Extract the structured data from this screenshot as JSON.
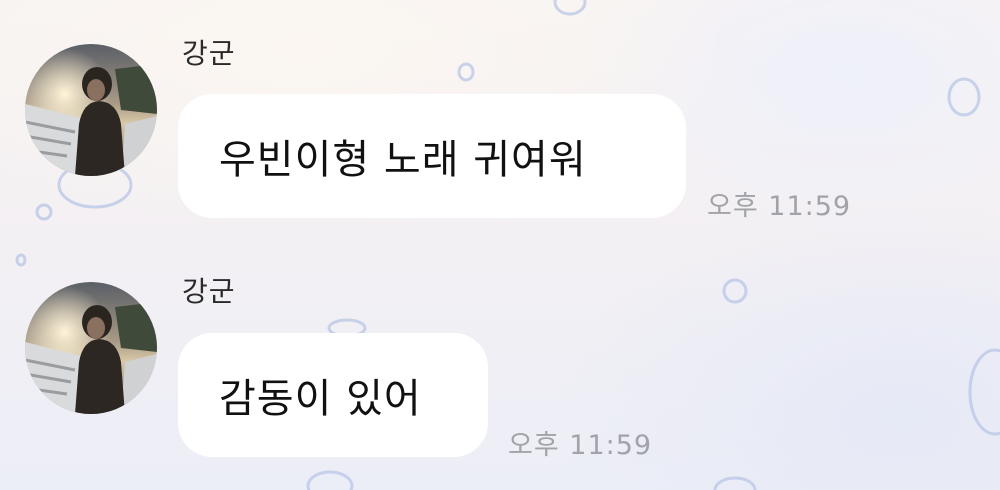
{
  "chat": {
    "messages": [
      {
        "sender": "강군",
        "text": "우빈이형 노래 귀여워",
        "time": "오후 11:59",
        "avatar_icon": "profile-photo"
      },
      {
        "sender": "강군",
        "text": "감동이 있어",
        "time": "오후 11:59",
        "avatar_icon": "profile-photo"
      }
    ]
  },
  "colors": {
    "bubble": "#ffffff",
    "timestamp": "#a2a3a8",
    "sender_text": "#2a2a2a",
    "message_text": "#111111",
    "background_bubbles": "#b9c8e8"
  }
}
